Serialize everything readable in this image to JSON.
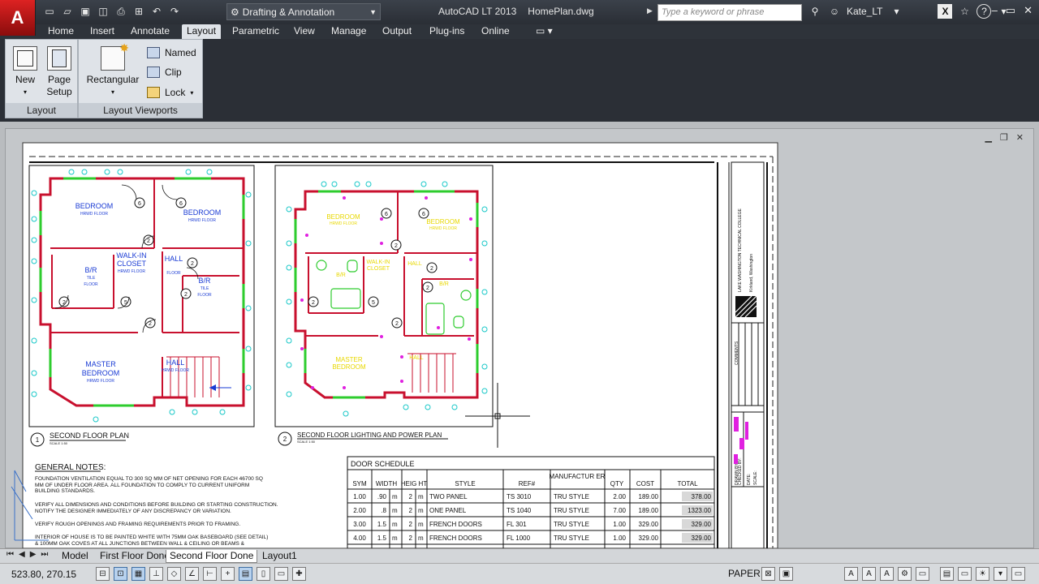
{
  "titlebar": {
    "app_letter": "A",
    "workspace": "Drafting & Annotation",
    "app_name": "AutoCAD LT 2013",
    "file_name": "HomePlan.dwg",
    "search_placeholder": "Type a keyword or phrase",
    "user": "Kate_LT"
  },
  "tabs": [
    "Home",
    "Insert",
    "Annotate",
    "Layout",
    "Parametric",
    "View",
    "Manage",
    "Output",
    "Plug-ins",
    "Online"
  ],
  "active_tab": "Layout",
  "ribbon": {
    "layout_panel": {
      "title": "Layout",
      "new": "New",
      "page_setup_1": "Page",
      "page_setup_2": "Setup"
    },
    "viewports_panel": {
      "title": "Layout Viewports",
      "rectangular": "Rectangular",
      "named": "Named",
      "clip": "Clip",
      "lock": "Lock"
    }
  },
  "drawing": {
    "plan1": {
      "number": "1",
      "title": "SECOND FLOOR PLAN",
      "scale": "SCALE 1:50"
    },
    "plan2": {
      "number": "2",
      "title": "SECOND FLOOR LIGHTING AND POWER PLAN",
      "scale": "SCALE 1:50"
    },
    "rooms": {
      "bedroom": "BEDROOM",
      "hrwd": "HRWD FLOOR",
      "walkin1": "WALK-IN",
      "walkin2": "CLOSET",
      "hall": "HALL",
      "br": "B/R",
      "tile": "TILE",
      "floor": "FLOOR",
      "master": "MASTER",
      "mbed": "BEDROOM"
    },
    "notes": {
      "heading": "GENERAL NOTES:",
      "lines": [
        "FOUNDATION VENTILATION EQUAL TO 300 SQ MM OF NET OPENING FOR EACH 46700 SQ",
        "MM OF UNDER FLOOR AREA. ALL FOUNDATION TO COMPLY TO CURRENT UNIFORM",
        "BUILDING STANDARDS.",
        "VERIFY ALL DIMENSIONS AND CONDITIONS BEFORE BUILDING OR STARTING CONSTRUCTION.",
        "NOTIFY THE DESIGNER IMMEDIATELY OF ANY DISCREPANCY OR VARIATION.",
        "VERIFY ROUGH OPENINGS AND FRAMING REQUIREMENTS PRIOR TO FRAMING.",
        "INTERIOR OF HOUSE IS TO BE PAINTED WHITE WITH 75MM OAK BASEBOARD (SEE DETAIL)",
        "& 100MM OAK COVES AT ALL JUNCTIONS BETWEEN WALL & CEILING OR BEAMS &"
      ]
    },
    "door_schedule": {
      "title": "DOOR SCHEDULE",
      "headers": [
        "SYM",
        "WIDTH",
        "HEIG HT",
        "STYLE",
        "REF#",
        "MANUFACTUR ER",
        "QTY",
        "COST",
        "TOTAL"
      ],
      "rows": [
        [
          "1.00",
          ".90",
          "m",
          "2",
          "m",
          "TWO PANEL",
          "TS 3010",
          "TRU STYLE",
          "2.00",
          "189.00",
          "378.00"
        ],
        [
          "2.00",
          ".8",
          "m",
          "2",
          "m",
          "ONE PANEL",
          "TS 1040",
          "TRU STYLE",
          "7.00",
          "189.00",
          "1323.00"
        ],
        [
          "3.00",
          "1.5",
          "m",
          "2",
          "m",
          "FRENCH DOORS",
          "FL 301",
          "TRU STYLE",
          "1.00",
          "329.00",
          "329.00"
        ],
        [
          "4.00",
          "1.5",
          "m",
          "2",
          "m",
          "FRENCH DOORS",
          "FL 1000",
          "TRU STYLE",
          "1.00",
          "329.00",
          "329.00"
        ]
      ]
    },
    "titleblock": {
      "school": "LAKE WASHINGTON TECHNICAL COLLEGE",
      "city": "Kirkland, Washington",
      "comments": "COMMENTS",
      "drawn": "DRAWN BY:",
      "checked": "CHECKED BY:",
      "date": "DATE:",
      "scale": "SCALE:"
    }
  },
  "layout_tabs": [
    "Model",
    "First Floor Done",
    "Second Floor Done",
    "Layout1"
  ],
  "status": {
    "coords": "523.80, 270.15",
    "space": "PAPER"
  },
  "colors": {
    "accent_red": "#c8102e",
    "wall": "#c8102e",
    "text_blue": "#1a3bd4",
    "dim_cyan": "#18c8c8",
    "window_green": "#2ecc2e",
    "magenta": "#e020e0",
    "yellow": "#e8d800"
  }
}
